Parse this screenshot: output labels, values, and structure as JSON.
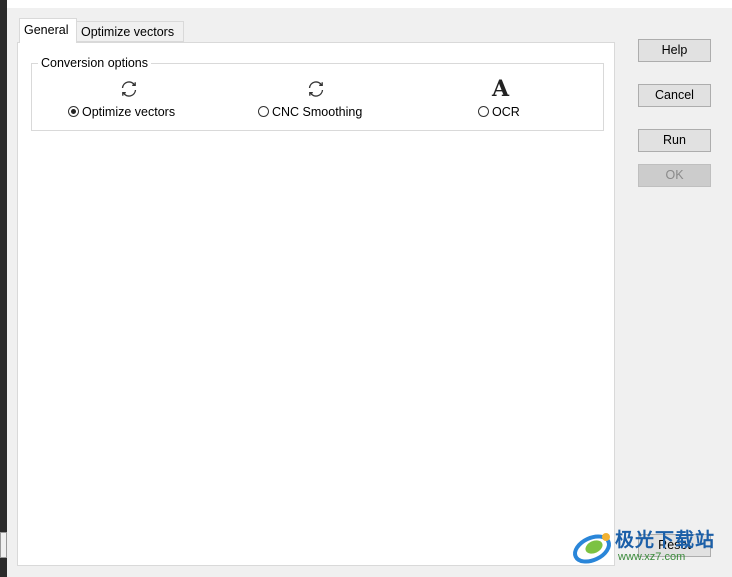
{
  "tabs": [
    {
      "label": "General",
      "active": true
    },
    {
      "label": "Optimize vectors",
      "active": false
    }
  ],
  "conversion_group": {
    "legend": "Conversion options",
    "options": [
      {
        "label": "Optimize vectors",
        "icon": "refresh-icon",
        "selected": true
      },
      {
        "label": "CNC Smoothing",
        "icon": "refresh-icon",
        "selected": false
      },
      {
        "label": "OCR",
        "icon": "ocr-letter-a-icon",
        "glyph": "A",
        "selected": false
      }
    ]
  },
  "buttons": {
    "help": "Help",
    "cancel": "Cancel",
    "run": "Run",
    "ok": "OK",
    "reset": "Reset"
  },
  "watermark": {
    "text": "极光下载站",
    "url": "www.xz7.com"
  },
  "colors": {
    "dialog_bg": "#f0f0f0",
    "panel_bg": "#ffffff",
    "border": "#d9d9d9",
    "button_bg": "#e1e1e1",
    "watermark_blue": "#1b5fa8"
  }
}
